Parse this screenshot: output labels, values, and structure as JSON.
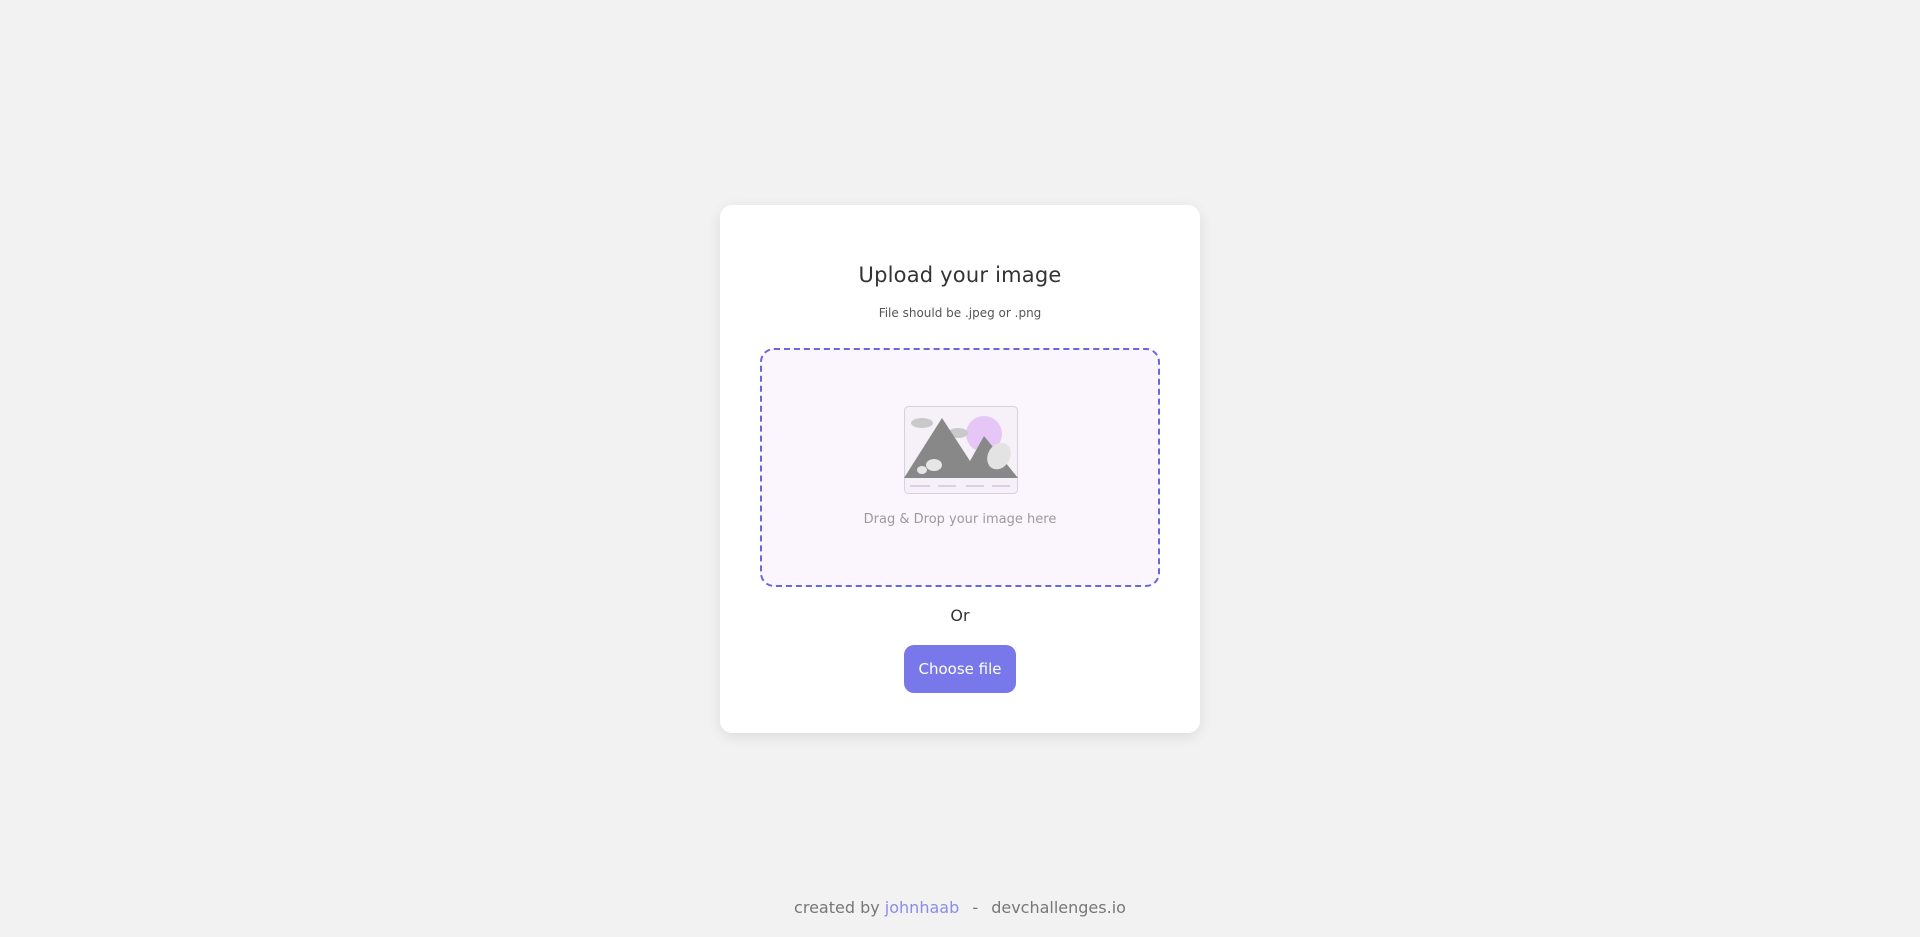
{
  "card": {
    "title": "Upload your image",
    "subtitle": "File should be .jpeg or .png",
    "dropzone_text": "Drag & Drop your image here",
    "or_text": "Or",
    "choose_button_label": "Choose file"
  },
  "footer": {
    "created_by": "created by",
    "author": "johnhaab",
    "separator": "-",
    "site": "devchallenges.io"
  },
  "colors": {
    "background": "#f2f2f2",
    "accent": "#7878ea",
    "dropzone_bg": "#fbf5fd",
    "dropzone_border": "#6767e0",
    "author_link": "#8c8ce8"
  },
  "icons": {
    "illustration": "mountain-image-placeholder-icon"
  }
}
